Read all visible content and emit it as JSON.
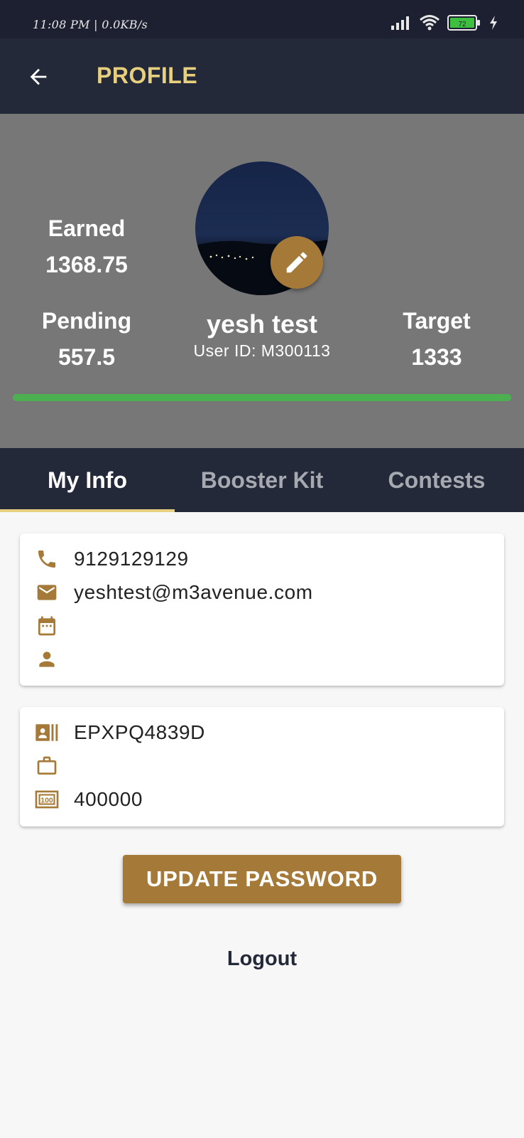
{
  "status_bar": {
    "time_speed": "11:08 PM | 0.0KB/s",
    "battery": "72",
    "icons": [
      "signal-icon",
      "wifi-icon",
      "battery-icon",
      "charging-icon"
    ]
  },
  "app_bar": {
    "title": "PROFILE",
    "back_icon": "back-arrow-icon"
  },
  "profile": {
    "name": "yesh test",
    "user_id": "User ID: M300113",
    "earned_label": "Earned",
    "earned_value": "1368.75",
    "pending_label": "Pending",
    "pending_value": "557.5",
    "target_label": "Target",
    "target_value": "1333",
    "progress_fraction": 1.0,
    "edit_icon": "pencil-icon"
  },
  "tabs": [
    {
      "label": "My Info"
    },
    {
      "label": "Booster Kit"
    },
    {
      "label": "Contests"
    }
  ],
  "contact_card": {
    "phone": "9129129129",
    "email": "yeshtest@m3avenue.com",
    "dob": "",
    "gender": ""
  },
  "work_card": {
    "pan": "EPXPQ4839D",
    "occupation": "",
    "income": "400000"
  },
  "actions": {
    "update_password": "UPDATE PASSWORD",
    "logout": "Logout"
  },
  "colors": {
    "app_bar": "#232939",
    "accent_gold": "#a57a38",
    "title_yellow": "#e6cf7e",
    "progress_green": "#4caf50",
    "header_gray": "#777777"
  }
}
